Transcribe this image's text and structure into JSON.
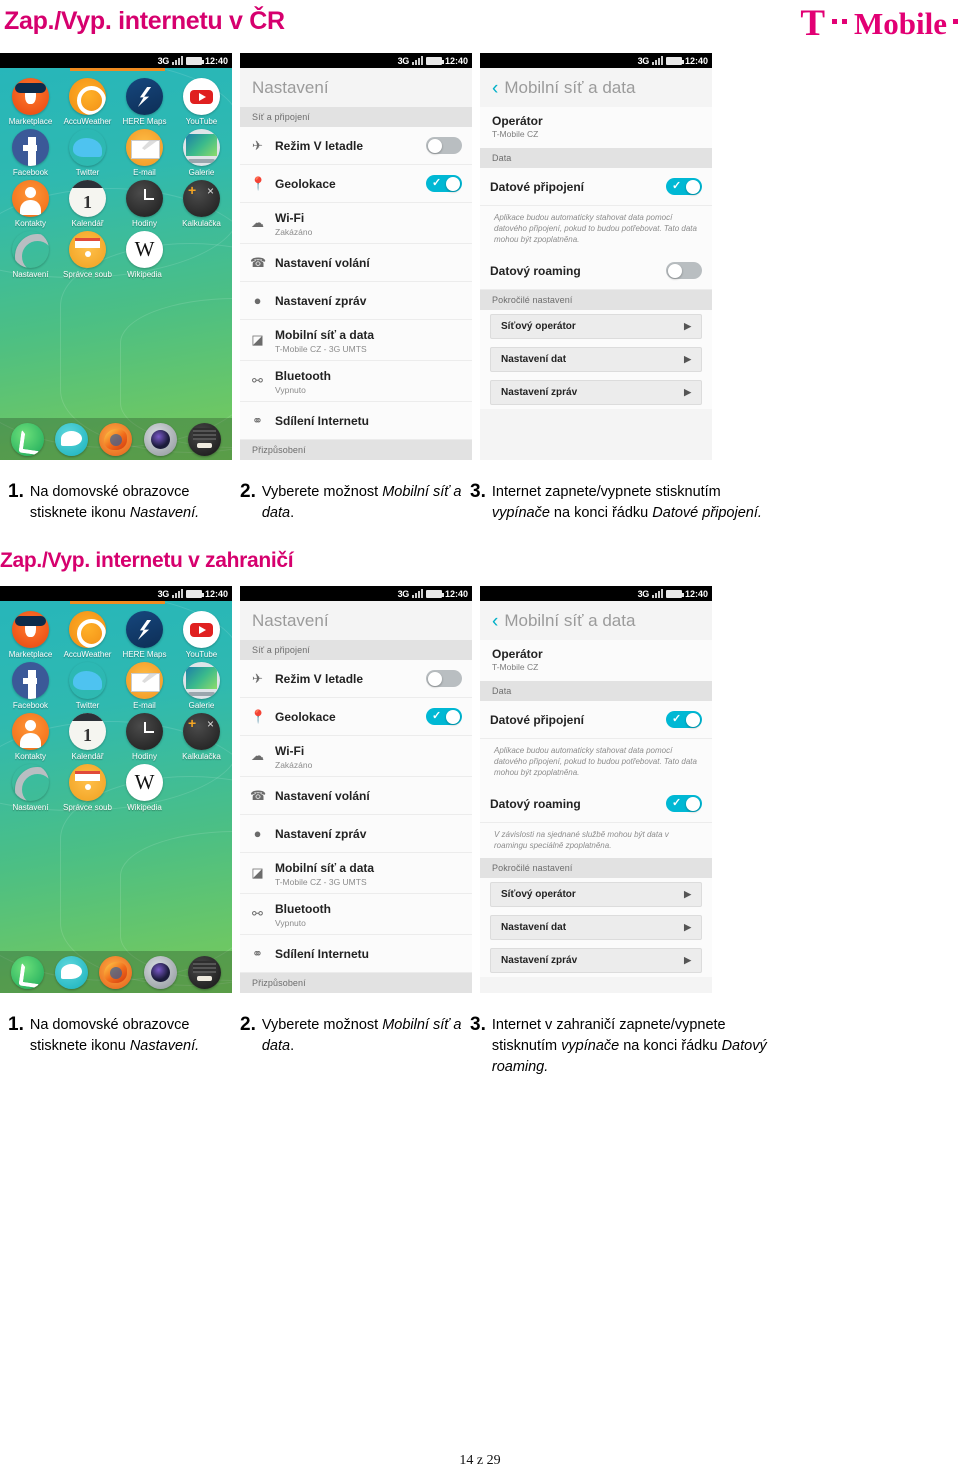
{
  "brand": {
    "logo_text": "Mobile",
    "logo_t": "T",
    "accent": "#e20074"
  },
  "sections": [
    {
      "title": "Zap./Vyp. internetu v ČR",
      "steps": [
        {
          "num": "1.",
          "parts": [
            {
              "t": "Na domovské obrazovce stisknete ikonu ",
              "i": false
            },
            {
              "t": "Nastavení.",
              "i": true
            }
          ]
        },
        {
          "num": "2.",
          "parts": [
            {
              "t": "Vyberete možnost ",
              "i": false
            },
            {
              "t": "Mobilní síť a data",
              "i": true
            },
            {
              "t": ".",
              "i": false
            }
          ]
        },
        {
          "num": "3.",
          "parts": [
            {
              "t": "Internet zapnete/vypnete stisknutím ",
              "i": false
            },
            {
              "t": "vypínače",
              "i": true
            },
            {
              "t": " na konci řádku ",
              "i": false
            },
            {
              "t": "Datové připojení.",
              "i": true
            }
          ]
        }
      ]
    },
    {
      "title": "Zap./Vyp. internetu v zahraničí",
      "steps": [
        {
          "num": "1.",
          "parts": [
            {
              "t": "Na domovské obrazovce stisknete ikonu ",
              "i": false
            },
            {
              "t": "Nastavení.",
              "i": true
            }
          ]
        },
        {
          "num": "2.",
          "parts": [
            {
              "t": "Vyberete možnost ",
              "i": false
            },
            {
              "t": "Mobilní síť a data",
              "i": true
            },
            {
              "t": ".",
              "i": false
            }
          ]
        },
        {
          "num": "3.",
          "parts": [
            {
              "t": "Internet v zahraničí zapnete/vypnete stisknutím ",
              "i": false
            },
            {
              "t": "vypínače",
              "i": true
            },
            {
              "t": " na konci řádku ",
              "i": false
            },
            {
              "t": "Datový roaming.",
              "i": true
            }
          ]
        }
      ]
    }
  ],
  "statusbar": {
    "network": "3G",
    "time": "12:40"
  },
  "home": {
    "apps": [
      {
        "label": "Marketplace",
        "icon": "marketplace-icon"
      },
      {
        "label": "AccuWeather",
        "icon": "accuweather-icon"
      },
      {
        "label": "HERE Maps",
        "icon": "here-maps-icon"
      },
      {
        "label": "YouTube",
        "icon": "youtube-icon"
      },
      {
        "label": "Facebook",
        "icon": "facebook-icon"
      },
      {
        "label": "Twitter",
        "icon": "twitter-icon"
      },
      {
        "label": "E-mail",
        "icon": "email-icon"
      },
      {
        "label": "Galerie",
        "icon": "galerie-icon"
      },
      {
        "label": "Kontakty",
        "icon": "kontakty-icon"
      },
      {
        "label": "Kalendář",
        "icon": "kalendar-icon"
      },
      {
        "label": "Hodiny",
        "icon": "hodiny-icon"
      },
      {
        "label": "Kalkulačka",
        "icon": "kalkulacka-icon"
      },
      {
        "label": "Nastavení",
        "icon": "nastaveni-icon"
      },
      {
        "label": "Správce soub",
        "icon": "spravce-souboru-icon"
      },
      {
        "label": "Wikipedia",
        "icon": "wikipedia-icon"
      }
    ],
    "dock": [
      "phone-icon",
      "messages-icon",
      "firefox-icon",
      "camera-icon",
      "more-apps-icon"
    ]
  },
  "settings_screen": {
    "title": "Nastavení",
    "section_label": "Síť a připojení",
    "rows": [
      {
        "title": "Režim V letadle",
        "sub": "",
        "icon": "airplane-icon",
        "toggle": "off"
      },
      {
        "title": "Geolokace",
        "sub": "",
        "icon": "location-pin-icon",
        "toggle": "on"
      },
      {
        "title": "Wi-Fi",
        "sub": "Zakázáno",
        "icon": "wifi-icon",
        "toggle": null
      },
      {
        "title": "Nastavení volání",
        "sub": "",
        "icon": "phone-icon",
        "toggle": null
      },
      {
        "title": "Nastavení zpráv",
        "sub": "",
        "icon": "message-bubble-icon",
        "toggle": null
      },
      {
        "title": "Mobilní síť a data",
        "sub": "T-Mobile CZ - 3G UMTS",
        "icon": "signal-bars-icon",
        "toggle": null
      },
      {
        "title": "Bluetooth",
        "sub": "Vypnuto",
        "icon": "bluetooth-icon",
        "toggle": null
      },
      {
        "title": "Sdílení Internetu",
        "sub": "",
        "icon": "tethering-icon",
        "toggle": null
      }
    ],
    "footer_label": "Přizpůsobení"
  },
  "network_screen": {
    "title": "Mobilní síť a data",
    "back_icon": "chevron-left-icon",
    "operator_label": "Operátor",
    "operator_value": "T-Mobile CZ",
    "data_section": "Data",
    "data_connection_label": "Datové připojení",
    "data_connection_note": "Aplikace budou automaticky stahovat data pomocí datového připojení, pokud to budou potřebovat. Tato data mohou být zpoplatněna.",
    "roaming_label": "Datový roaming",
    "roaming_note": "V závislosti na sjednané službě mohou být data v roamingu speciálně zpoplatněna.",
    "advanced_section": "Pokročilé nastavení",
    "buttons": [
      "Síťový operátor",
      "Nastavení dat",
      "Nastavení zpráv"
    ],
    "toggles_cz": {
      "data": "on",
      "roaming": "off"
    },
    "toggles_abroad": {
      "data": "on",
      "roaming": "on"
    }
  },
  "footer": {
    "page": "14 z 29"
  }
}
